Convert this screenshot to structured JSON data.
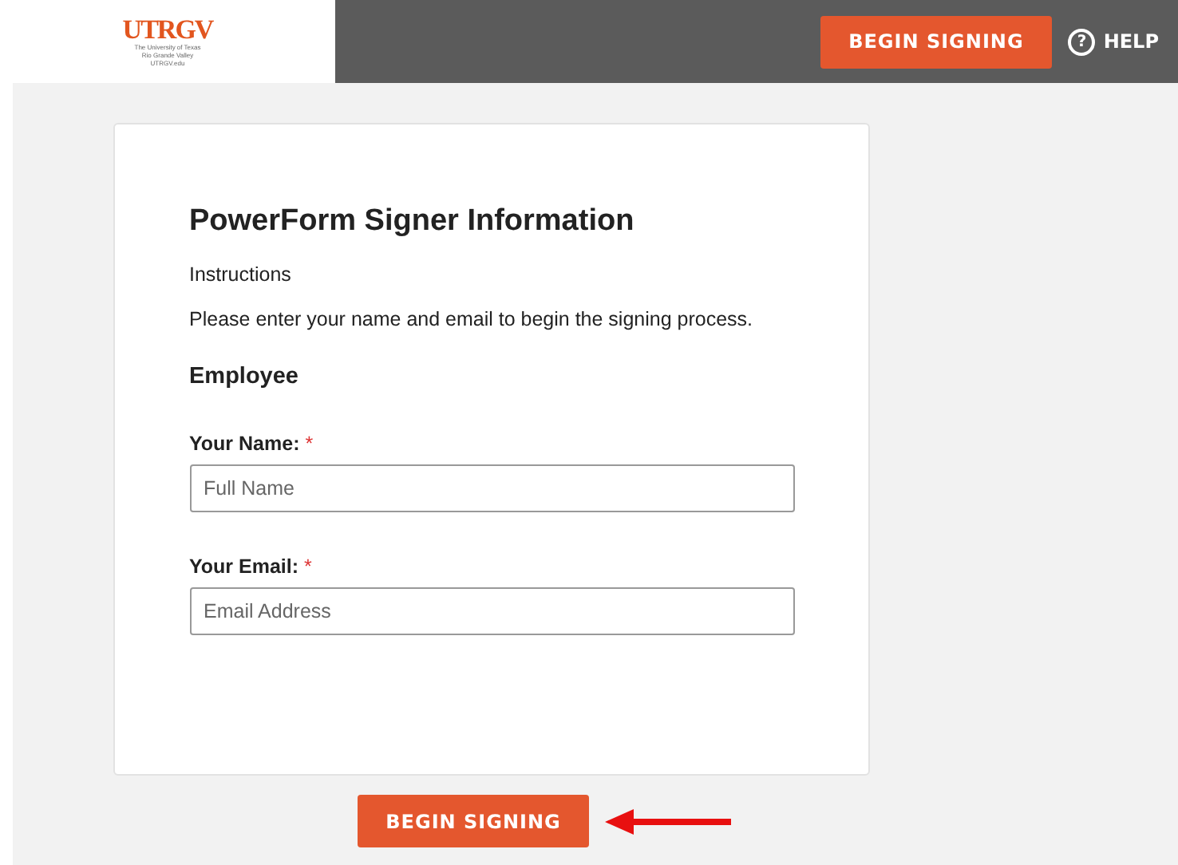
{
  "header": {
    "logo": {
      "wordmark": "UTRGV",
      "lines": [
        "The University of Texas",
        "Rio Grande Valley",
        "UTRGV.edu"
      ]
    },
    "begin_button": "BEGIN SIGNING",
    "help_icon": "?",
    "help": "HELP"
  },
  "form": {
    "title": "PowerForm Signer Information",
    "instructions_label": "Instructions",
    "instructions": "Please enter your name and email to begin the signing process.",
    "section": "Employee",
    "fields": [
      {
        "label": "Your Name:",
        "required_mark": "*",
        "placeholder": "Full Name"
      },
      {
        "label": "Your Email:",
        "required_mark": "*",
        "placeholder": "Email Address"
      }
    ]
  },
  "footer": {
    "begin_button": "BEGIN SIGNING"
  }
}
